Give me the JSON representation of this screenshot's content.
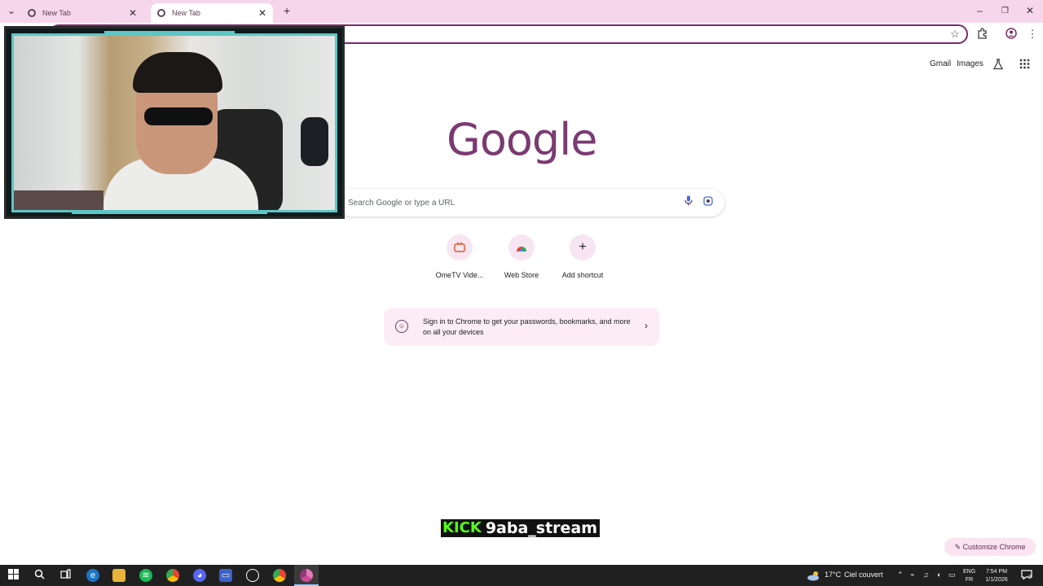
{
  "tabs": [
    {
      "title": "New Tab",
      "active": false
    },
    {
      "title": "New Tab",
      "active": true
    }
  ],
  "icons": {
    "tab_list": "chevron-down-icon",
    "new_tab": "plus-icon",
    "minimize": "minimize-icon",
    "restore": "restore-icon",
    "close": "close-icon",
    "bookmark": "star-icon",
    "extensions": "puzzle-icon",
    "profile": "profile-icon",
    "menu": "kebab-menu-icon"
  },
  "window_controls": {
    "minimize": "–",
    "restore": "❐",
    "close": "✕"
  },
  "ntp": {
    "links": {
      "gmail": "Gmail",
      "images": "Images"
    },
    "logo": "Google",
    "search_placeholder": "Search Google or type a URL",
    "shortcuts": [
      {
        "label": "OmeTV Vide...",
        "icon": "ometv-icon"
      },
      {
        "label": "Web Store",
        "icon": "webstore-icon"
      },
      {
        "label": "Add shortcut",
        "icon": "plus-icon"
      }
    ],
    "signin_text": "Sign in to Chrome to get your passwords, bookmarks, and more on all your devices",
    "customize_label": "Customize Chrome"
  },
  "watermark": {
    "brand": "KICK",
    "username": "9aba_stream"
  },
  "taskbar": {
    "weather_temp": "17°C",
    "weather_desc": "Ciel couvert",
    "lang_top": "ENG",
    "lang_bottom": "FR",
    "time": "7:54 PM",
    "date": "1/1/2026",
    "notification_count": "2"
  },
  "colors": {
    "tabstrip": "#f6d6ea",
    "accent": "#7a2a66",
    "kick_green": "#53fc18",
    "taskbar": "#202020"
  }
}
